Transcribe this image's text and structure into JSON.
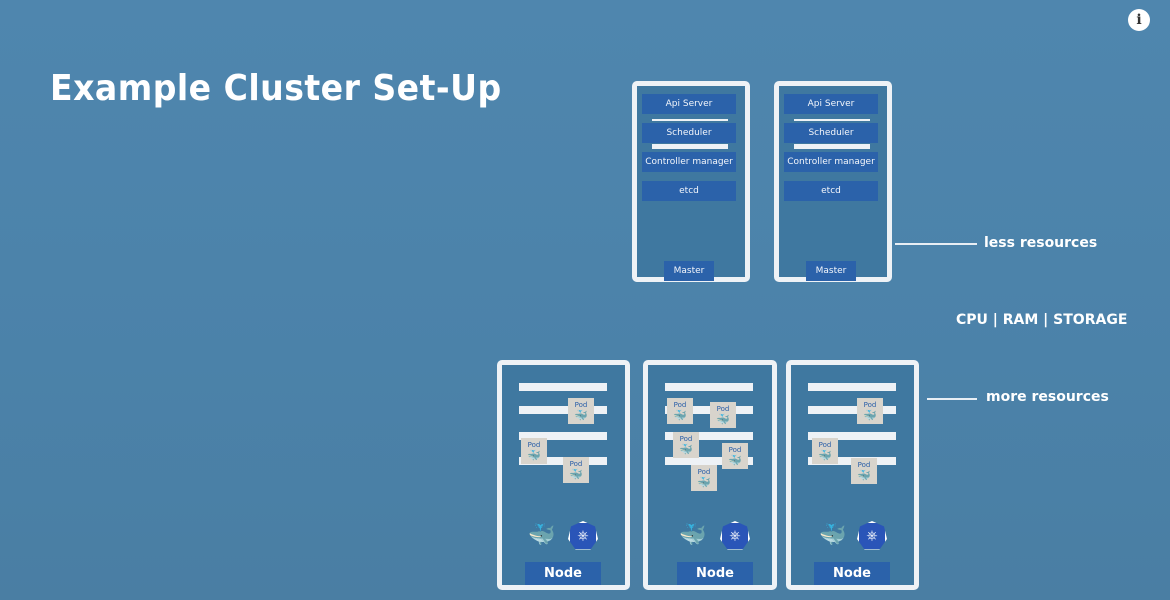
{
  "title": "Example Cluster Set-Up",
  "info_icon": "i",
  "masters": [
    {
      "items": [
        "Api Server",
        "Scheduler",
        "Controller manager",
        "etcd"
      ],
      "label": "Master"
    },
    {
      "items": [
        "Api Server",
        "Scheduler",
        "Controller manager",
        "etcd"
      ],
      "label": "Master"
    }
  ],
  "annotations": {
    "less": "less resources",
    "resources": "CPU | RAM | STORAGE",
    "more": "more resources"
  },
  "pod_label": "Pod",
  "nodes": [
    {
      "label": "Node"
    },
    {
      "label": "Node"
    },
    {
      "label": "Node"
    }
  ],
  "icons": {
    "docker": "docker-whale",
    "kubelet": "kubernetes-heptagon"
  }
}
